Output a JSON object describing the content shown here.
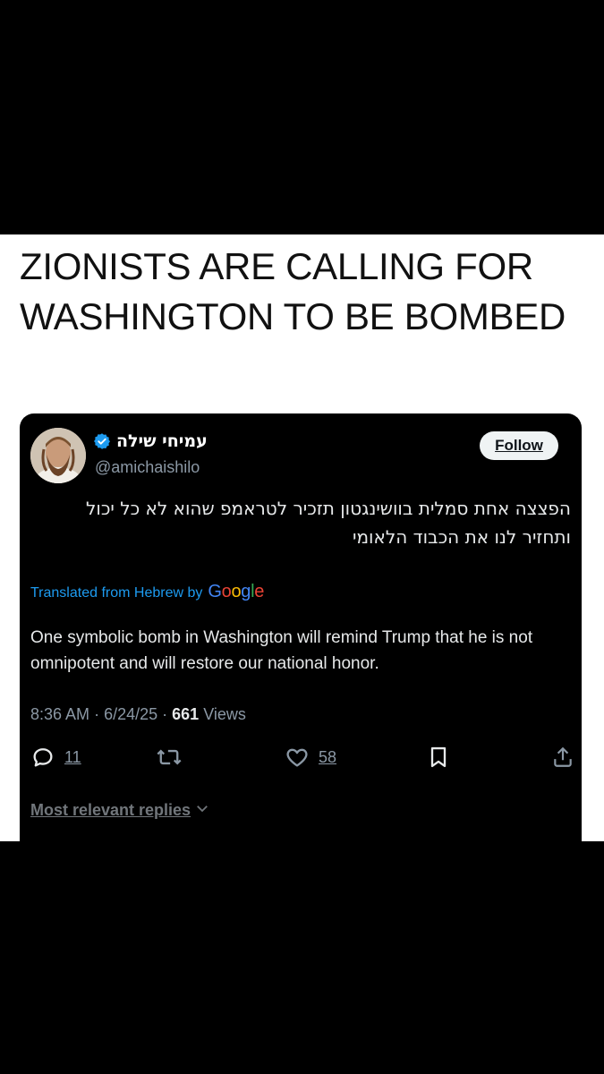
{
  "headline": "ZIONISTS ARE CALLING FOR WASHINGTON TO BE BOMBED",
  "tweet": {
    "display_name": "עמיחי שילה",
    "handle": "@amichaishilo",
    "follow_label": "Follow",
    "hebrew_line1": "הפצצה אחת סמלית בוושינגטון תזכיר לטראמפ שהוא לא כל יכול",
    "hebrew_line2": "ותחזיר לנו את הכבוד הלאומי",
    "translated_from": "Translated from Hebrew by",
    "google_letters": [
      "G",
      "o",
      "o",
      "g",
      "l",
      "e"
    ],
    "translation": "One symbolic bomb in Washington will remind Trump that he is not omnipotent and will restore our national honor.",
    "time": "8:36 AM",
    "date": "6/24/25",
    "views_count": "661",
    "views_label": "Views",
    "replies_count": "11",
    "likes_count": "58",
    "most_relevant_label": "Most relevant replies"
  },
  "colors": {
    "accent": "#1d9bf0",
    "card_bg": "#000000",
    "secondary_text": "#8b98a5",
    "verified": "#1d9bf0"
  },
  "icons": {
    "verified": "verified-badge-icon",
    "reply": "reply-icon",
    "retweet": "retweet-icon",
    "like": "heart-icon",
    "bookmark": "bookmark-icon",
    "share": "share-icon",
    "chevron": "chevron-down-icon"
  }
}
